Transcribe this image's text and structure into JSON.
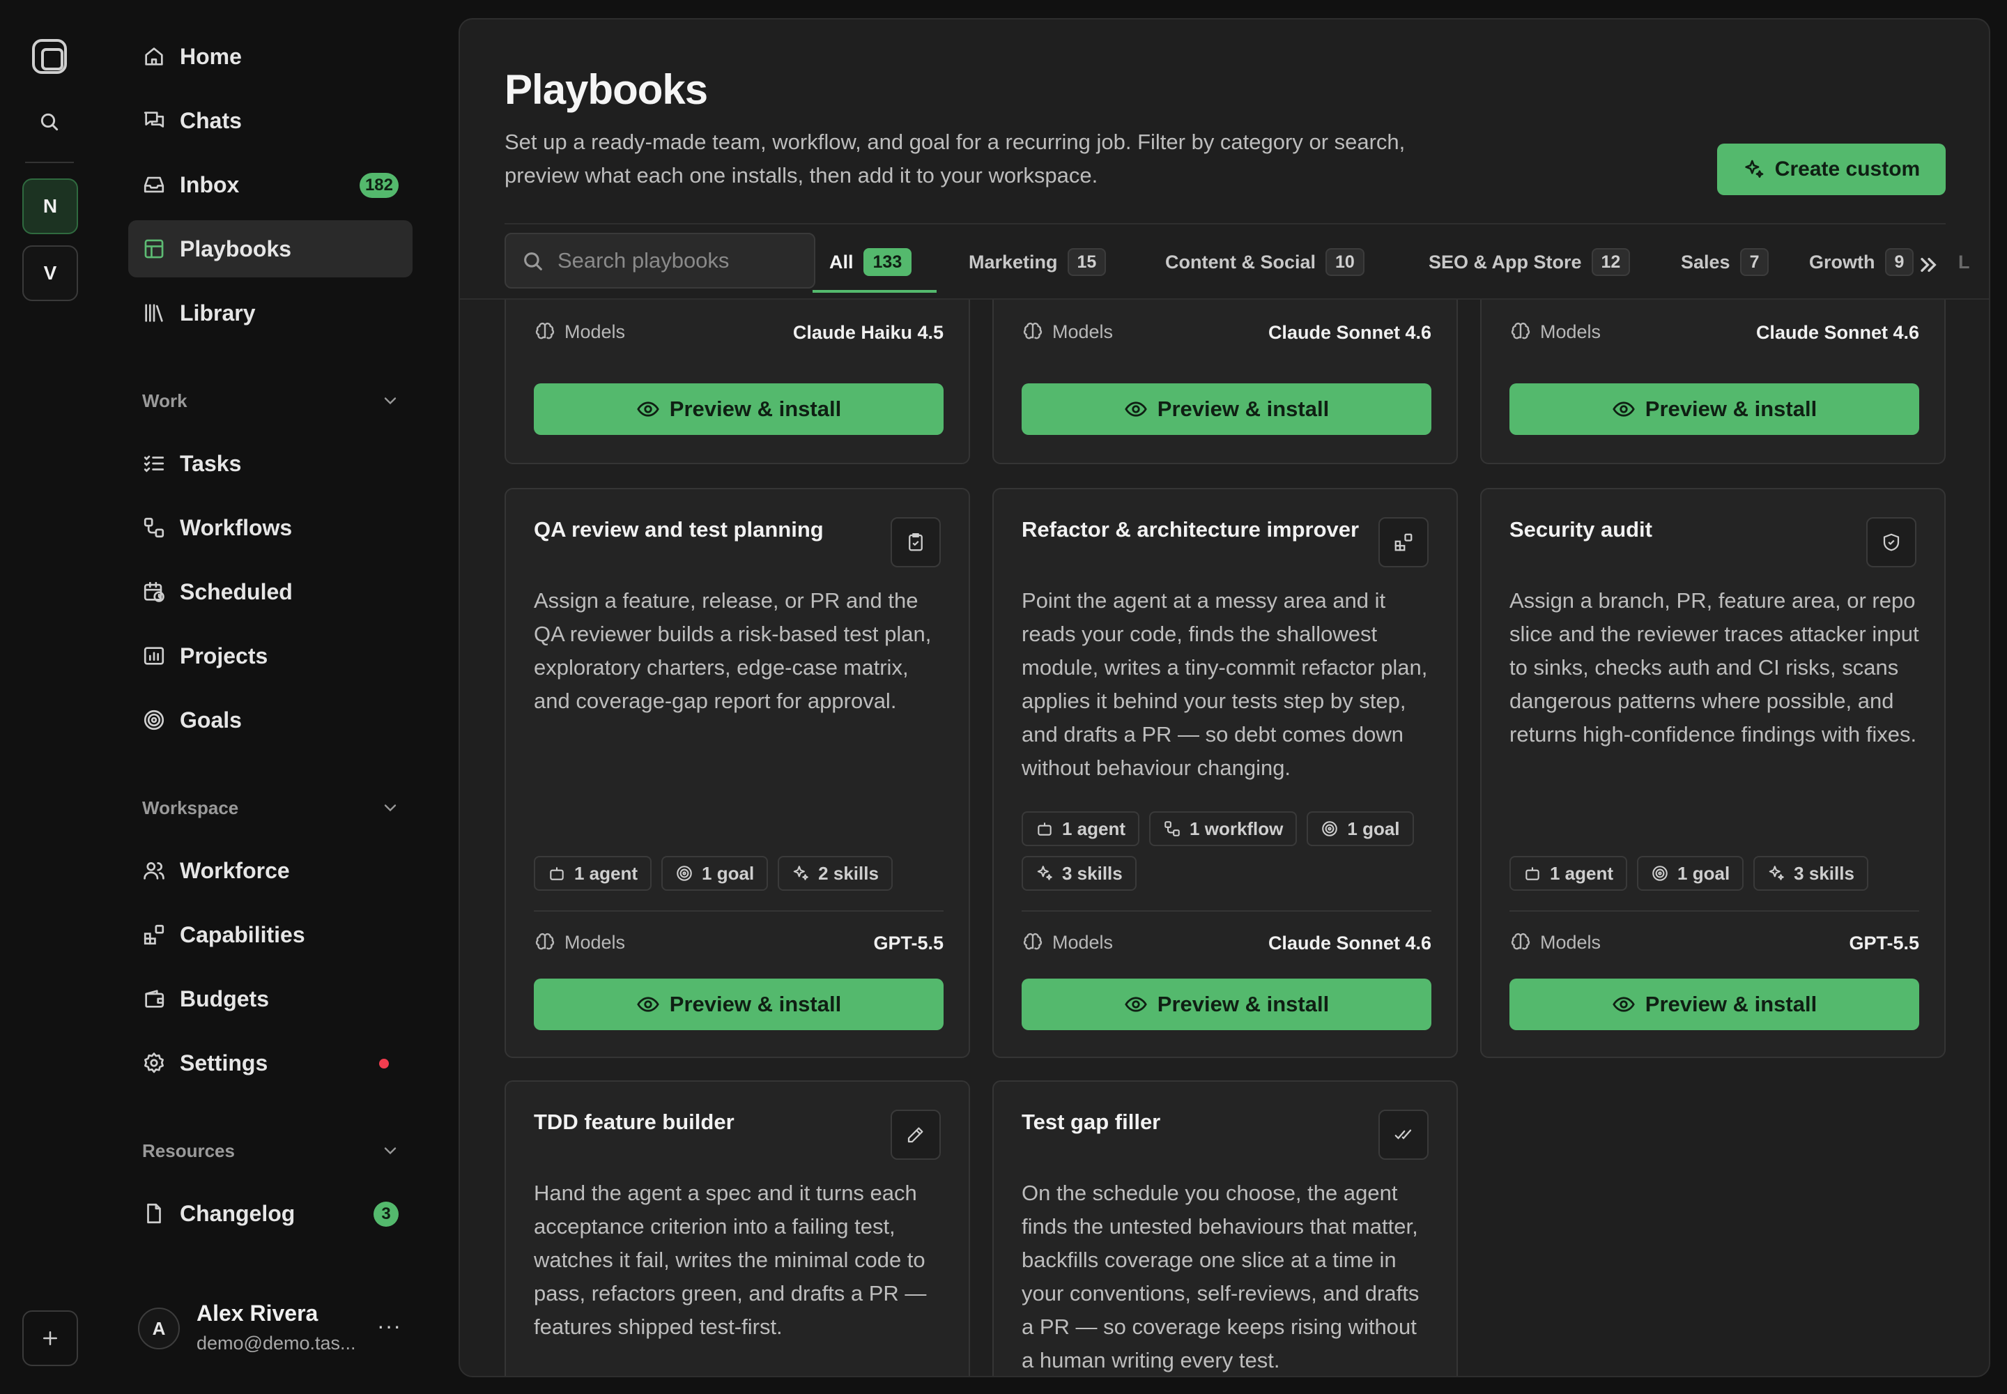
{
  "workspaces": [
    {
      "letter": "N"
    },
    {
      "letter": "V"
    }
  ],
  "sidebar": {
    "top_items": [
      {
        "label": "Home"
      },
      {
        "label": "Chats"
      },
      {
        "label": "Inbox",
        "badge": "182"
      },
      {
        "label": "Playbooks"
      },
      {
        "label": "Library"
      }
    ],
    "work_header": "Work",
    "work_items": [
      {
        "label": "Tasks"
      },
      {
        "label": "Workflows"
      },
      {
        "label": "Scheduled"
      },
      {
        "label": "Projects"
      },
      {
        "label": "Goals"
      }
    ],
    "workspace_header": "Workspace",
    "workspace_items": [
      {
        "label": "Workforce"
      },
      {
        "label": "Capabilities"
      },
      {
        "label": "Budgets"
      },
      {
        "label": "Settings"
      }
    ],
    "resources_header": "Resources",
    "resources_items": [
      {
        "label": "Changelog",
        "badge": "3"
      }
    ],
    "user": {
      "initial": "A",
      "name": "Alex Rivera",
      "email": "demo@demo.tas...",
      "more": "···"
    }
  },
  "page": {
    "title": "Playbooks",
    "description": "Set up a ready-made team, workflow, and goal for a recurring job. Filter by category or search, preview what each one installs, then add it to your workspace.",
    "create_label": "Create custom",
    "search_placeholder": "Search playbooks"
  },
  "tabs": [
    {
      "label": "All",
      "count": "133"
    },
    {
      "label": "Marketing",
      "count": "15"
    },
    {
      "label": "Content & Social",
      "count": "10"
    },
    {
      "label": "SEO & App Store",
      "count": "12"
    },
    {
      "label": "Sales",
      "count": "7"
    },
    {
      "label": "Growth",
      "count": "9"
    },
    {
      "label": "L"
    }
  ],
  "cards_top_partial": [
    {
      "models_label": "Models",
      "model": "Claude Haiku 4.5",
      "cta": "Preview & install"
    },
    {
      "models_label": "Models",
      "model": "Claude Sonnet 4.6",
      "cta": "Preview & install"
    },
    {
      "models_label": "Models",
      "model": "Claude Sonnet 4.6",
      "cta": "Preview & install"
    }
  ],
  "cards_mid": [
    {
      "title": "QA review and test planning",
      "icon": "clipboard-check-icon",
      "description": "Assign a feature, release, or PR and the QA reviewer builds a risk-based test plan, exploratory charters, edge-case matrix, and coverage-gap report for approval.",
      "chips": [
        "1 agent",
        "1 goal",
        "2 skills"
      ],
      "models_label": "Models",
      "model": "GPT-5.5",
      "cta": "Preview & install"
    },
    {
      "title": "Refactor & architecture improver",
      "icon": "blocks-icon",
      "description": "Point the agent at a messy area and it reads your code, finds the shallowest module, writes a tiny-commit refactor plan, applies it behind your tests step by step, and drafts a PR — so debt comes down without behaviour changing.",
      "chips": [
        "1 agent",
        "1 workflow",
        "1 goal",
        "3 skills"
      ],
      "models_label": "Models",
      "model": "Claude Sonnet 4.6",
      "cta": "Preview & install"
    },
    {
      "title": "Security audit",
      "icon": "shield-check-icon",
      "description": "Assign a branch, PR, feature area, or repo slice and the reviewer traces attacker input to sinks, checks auth and CI risks, scans dangerous patterns where possible, and returns high-confidence findings with fixes.",
      "chips": [
        "1 agent",
        "1 goal",
        "3 skills"
      ],
      "models_label": "Models",
      "model": "GPT-5.5",
      "cta": "Preview & install"
    }
  ],
  "cards_bottom": [
    {
      "title": "TDD feature builder",
      "icon": "pencil-icon",
      "description": "Hand the agent a spec and it turns each acceptance criterion into a failing test, watches it fail, writes the minimal code to pass, refactors green, and drafts a PR — features shipped test-first."
    },
    {
      "title": "Test gap filler",
      "icon": "double-check-icon",
      "description": "On the schedule you choose, the agent finds the untested behaviours that matter, backfills coverage one slice at a time in your conventions, self-reviews, and drafts a PR — so coverage keeps rising without a human writing every test."
    }
  ],
  "colors": {
    "accent": "#54b96d",
    "background": "#111111",
    "panel": "#1f1f1f",
    "card": "#242424",
    "alert_dot": "#f23d4f"
  }
}
